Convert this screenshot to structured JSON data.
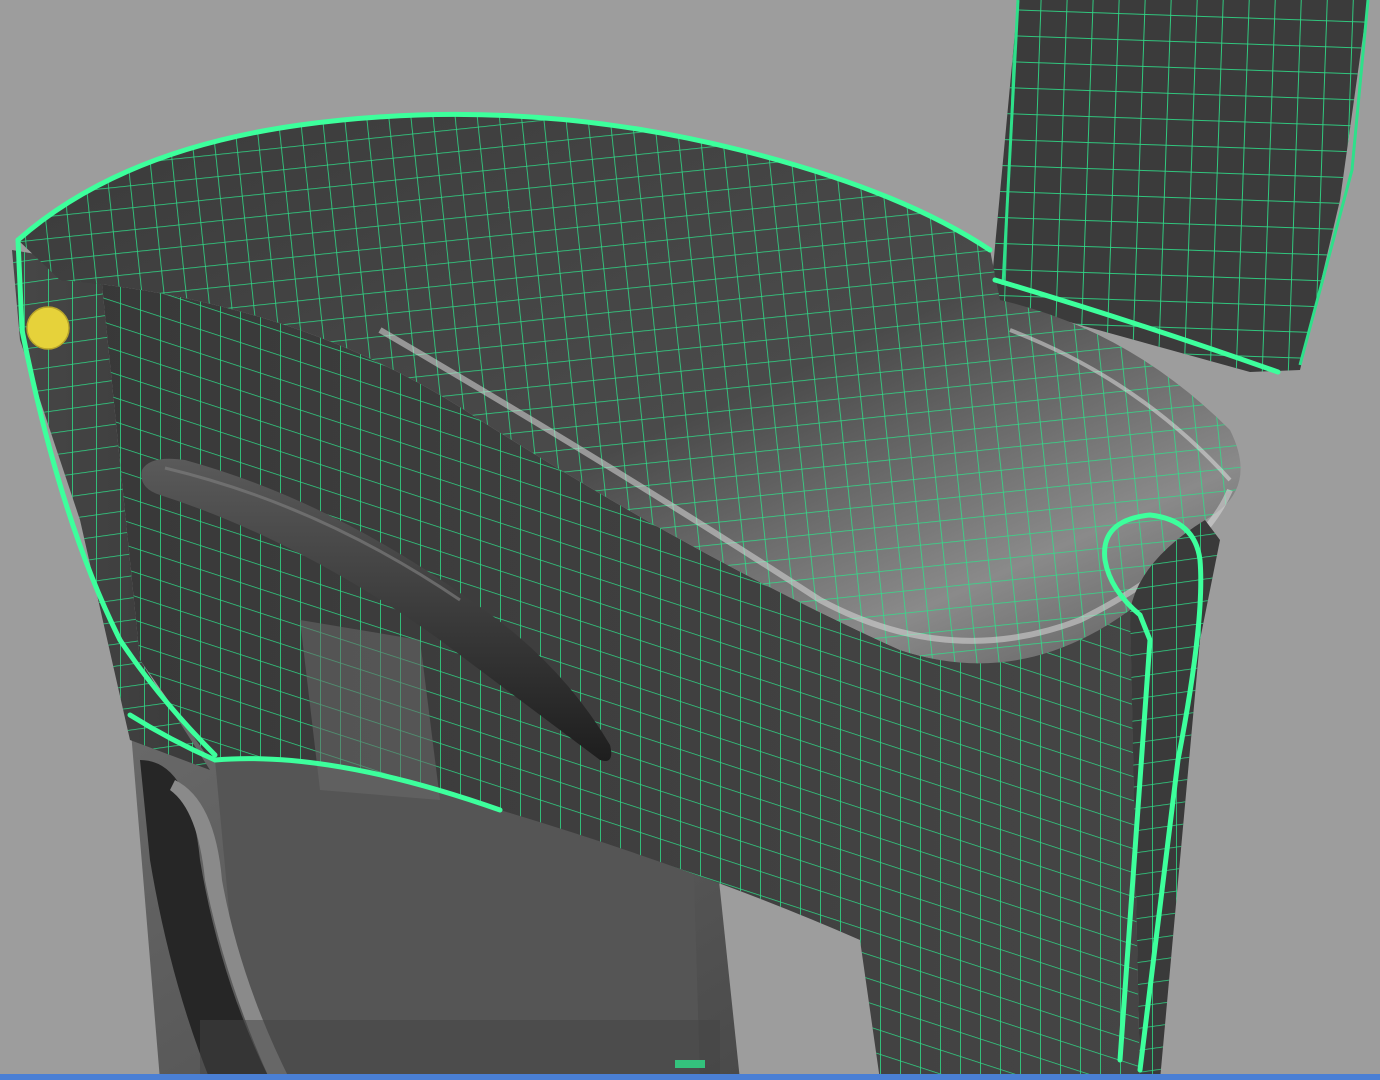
{
  "viewport": {
    "background_color": "#9d9d9d",
    "mesh_color": "#2ee08a",
    "selection_edge_color": "#3dff9c",
    "surface_dark_color": "#3e3e3e",
    "surface_mid_color": "#585858",
    "highlight_color": "#cfcfcf",
    "manipulator_color": "#e6d23a",
    "status_strip_color": "#4a7fd4"
  },
  "icons": {
    "manipulator": "yellow-dot-manipulator-icon"
  }
}
